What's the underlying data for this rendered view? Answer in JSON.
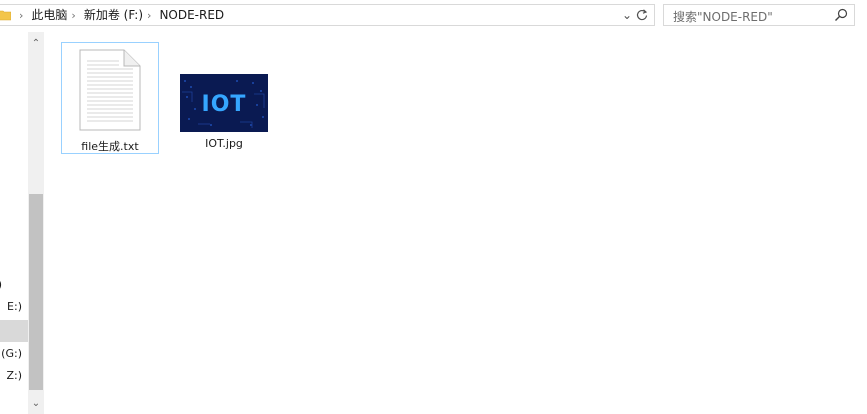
{
  "breadcrumb": {
    "items": [
      "此电脑",
      "新加卷 (F:)",
      "NODE-RED"
    ]
  },
  "search": {
    "placeholder": "搜索\"NODE-RED\""
  },
  "nav": {
    "items": [
      {
        "label": ")"
      },
      {
        "label": "E:)"
      },
      {
        "label": ""
      },
      {
        "label": "(G:)"
      },
      {
        "label": "Z:)"
      }
    ]
  },
  "files": [
    {
      "name": "file生成.txt",
      "type": "text-document"
    },
    {
      "name": "IOT.jpg",
      "type": "image",
      "thumbnail_text": "IOT"
    }
  ],
  "colors": {
    "selection_border": "#99d1ff",
    "nav_selected": "#d9d9d9",
    "scrollbar_thumb": "#c2c2c2",
    "folder_yellow": "#f3c54a",
    "iot_background": "#0a1a52",
    "iot_accent": "#35a6ff"
  }
}
